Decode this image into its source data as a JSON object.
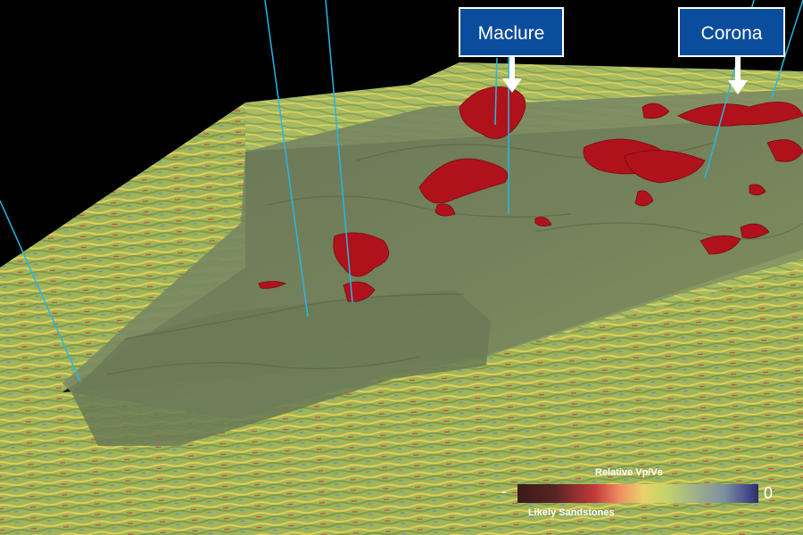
{
  "labels": {
    "maclure": "Maclure",
    "corona": "Corona"
  },
  "legend": {
    "title": "Relative Vp/Vs",
    "min_symbol": "-",
    "max_value": "0",
    "subtitle": "Likely Sandstones",
    "colors": [
      "#3b1a1a",
      "#5a2626",
      "#c23a3a",
      "#ef8a62",
      "#e9d26a",
      "#c2d36a",
      "#9fb08a",
      "#7d8f9e",
      "#4a4f8c",
      "#2b2d66"
    ]
  },
  "colors": {
    "background": "#000000",
    "seismic_base": "#a9bf63",
    "surface": "#6f7f5a",
    "sandstone": "#b0121c",
    "well": "#27b7e6",
    "label_bg": "#0a4d9c"
  }
}
